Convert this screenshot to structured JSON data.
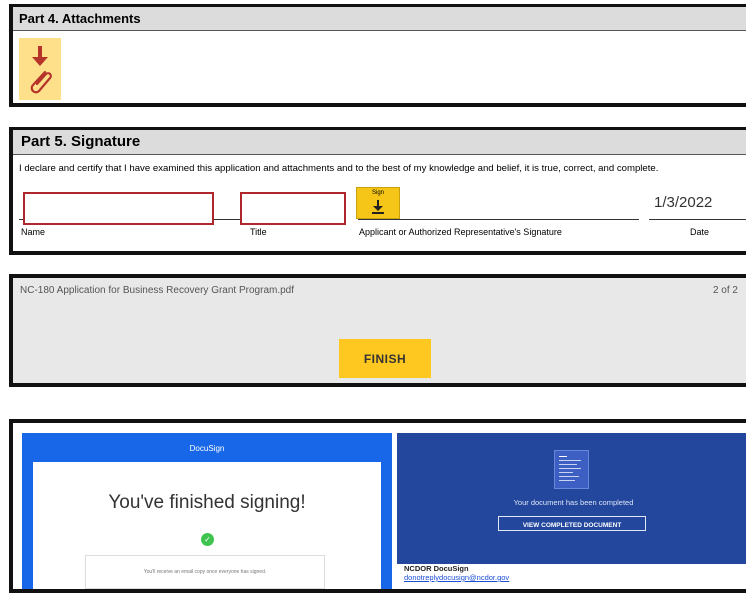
{
  "part4": {
    "title": "Part 4. Attachments"
  },
  "part5": {
    "title": "Part 5. Signature",
    "declaration": "I declare and certify that I have examined this application and attachments and to the best of my knowledge and belief, it is true, correct, and complete.",
    "sign_label": "Sign",
    "date_value": "1/3/2022",
    "labels": {
      "name": "Name",
      "title": "Title",
      "signature": "Applicant or Authorized Representative's Signature",
      "date": "Date"
    },
    "colors": {
      "field_border": "#b0262d",
      "sign_button": "#f5c518"
    }
  },
  "finish_bar": {
    "filename": "NC-180 Application for Business Recovery Grant Program.pdf",
    "page_indicator": "2 of 2",
    "finish_label": "FINISH",
    "colors": {
      "finish_button": "#ffc820"
    }
  },
  "docusign_panel": {
    "brand": "DocuSign",
    "heading": "You've finished signing!",
    "note": "You'll receive an email copy once everyone has signed.",
    "colors": {
      "brand_blue": "#1767e8",
      "check_green": "#3ec44f"
    }
  },
  "completion_email": {
    "status": "Your document has been completed",
    "view_button": "VIEW COMPLETED DOCUMENT",
    "sender": "NCDOR DocuSign",
    "sender_email": "donotreplydocusign@ncdor.gov",
    "colors": {
      "panel_blue": "#22479d"
    }
  }
}
